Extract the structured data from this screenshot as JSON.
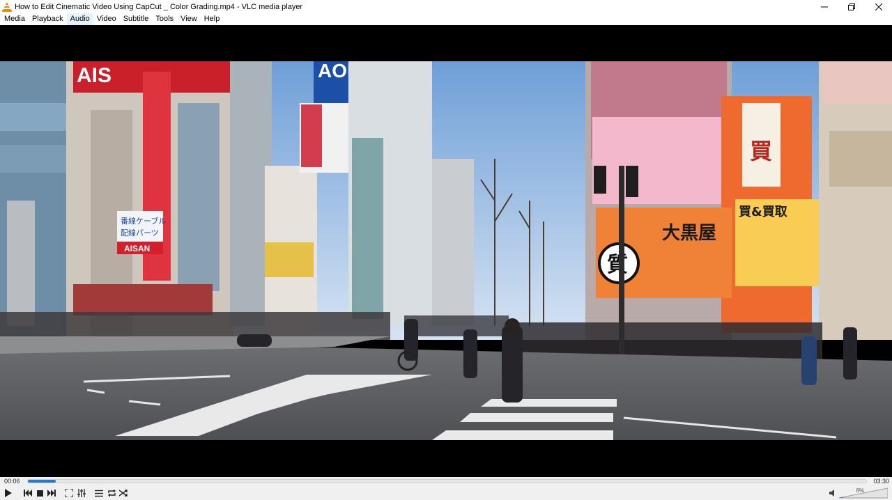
{
  "window": {
    "title": "How to Edit Cinematic Video Using CapCut _ Color Grading.mp4 - VLC media player",
    "app_icon": "vlc-cone-icon",
    "controls": [
      "minimize-icon",
      "maximize-icon",
      "close-icon"
    ]
  },
  "menu": {
    "items": [
      {
        "label": "Media"
      },
      {
        "label": "Playback"
      },
      {
        "label": "Audio"
      },
      {
        "label": "Video"
      },
      {
        "label": "Subtitle"
      },
      {
        "label": "Tools"
      },
      {
        "label": "View"
      },
      {
        "label": "Help"
      }
    ],
    "hovered": "Audio"
  },
  "video": {
    "signs": {
      "top_left": "AIS",
      "blue_building": "AOKI",
      "sign_line1": "番線ケーブル",
      "sign_line2": "配線パーツ",
      "aisan": "AISAN",
      "daikokuya": "大黒屋",
      "kaitori": "買&買取",
      "circle_char": "質",
      "vertical_char": "買"
    }
  },
  "playback": {
    "elapsed": "00:06",
    "total": "03:30",
    "progress_fraction": 0.033,
    "volume_label": "8%",
    "volume_fraction": 0.08
  },
  "colors": {
    "accent": "#1e7bd6",
    "vlc_orange": "#f08a00"
  }
}
